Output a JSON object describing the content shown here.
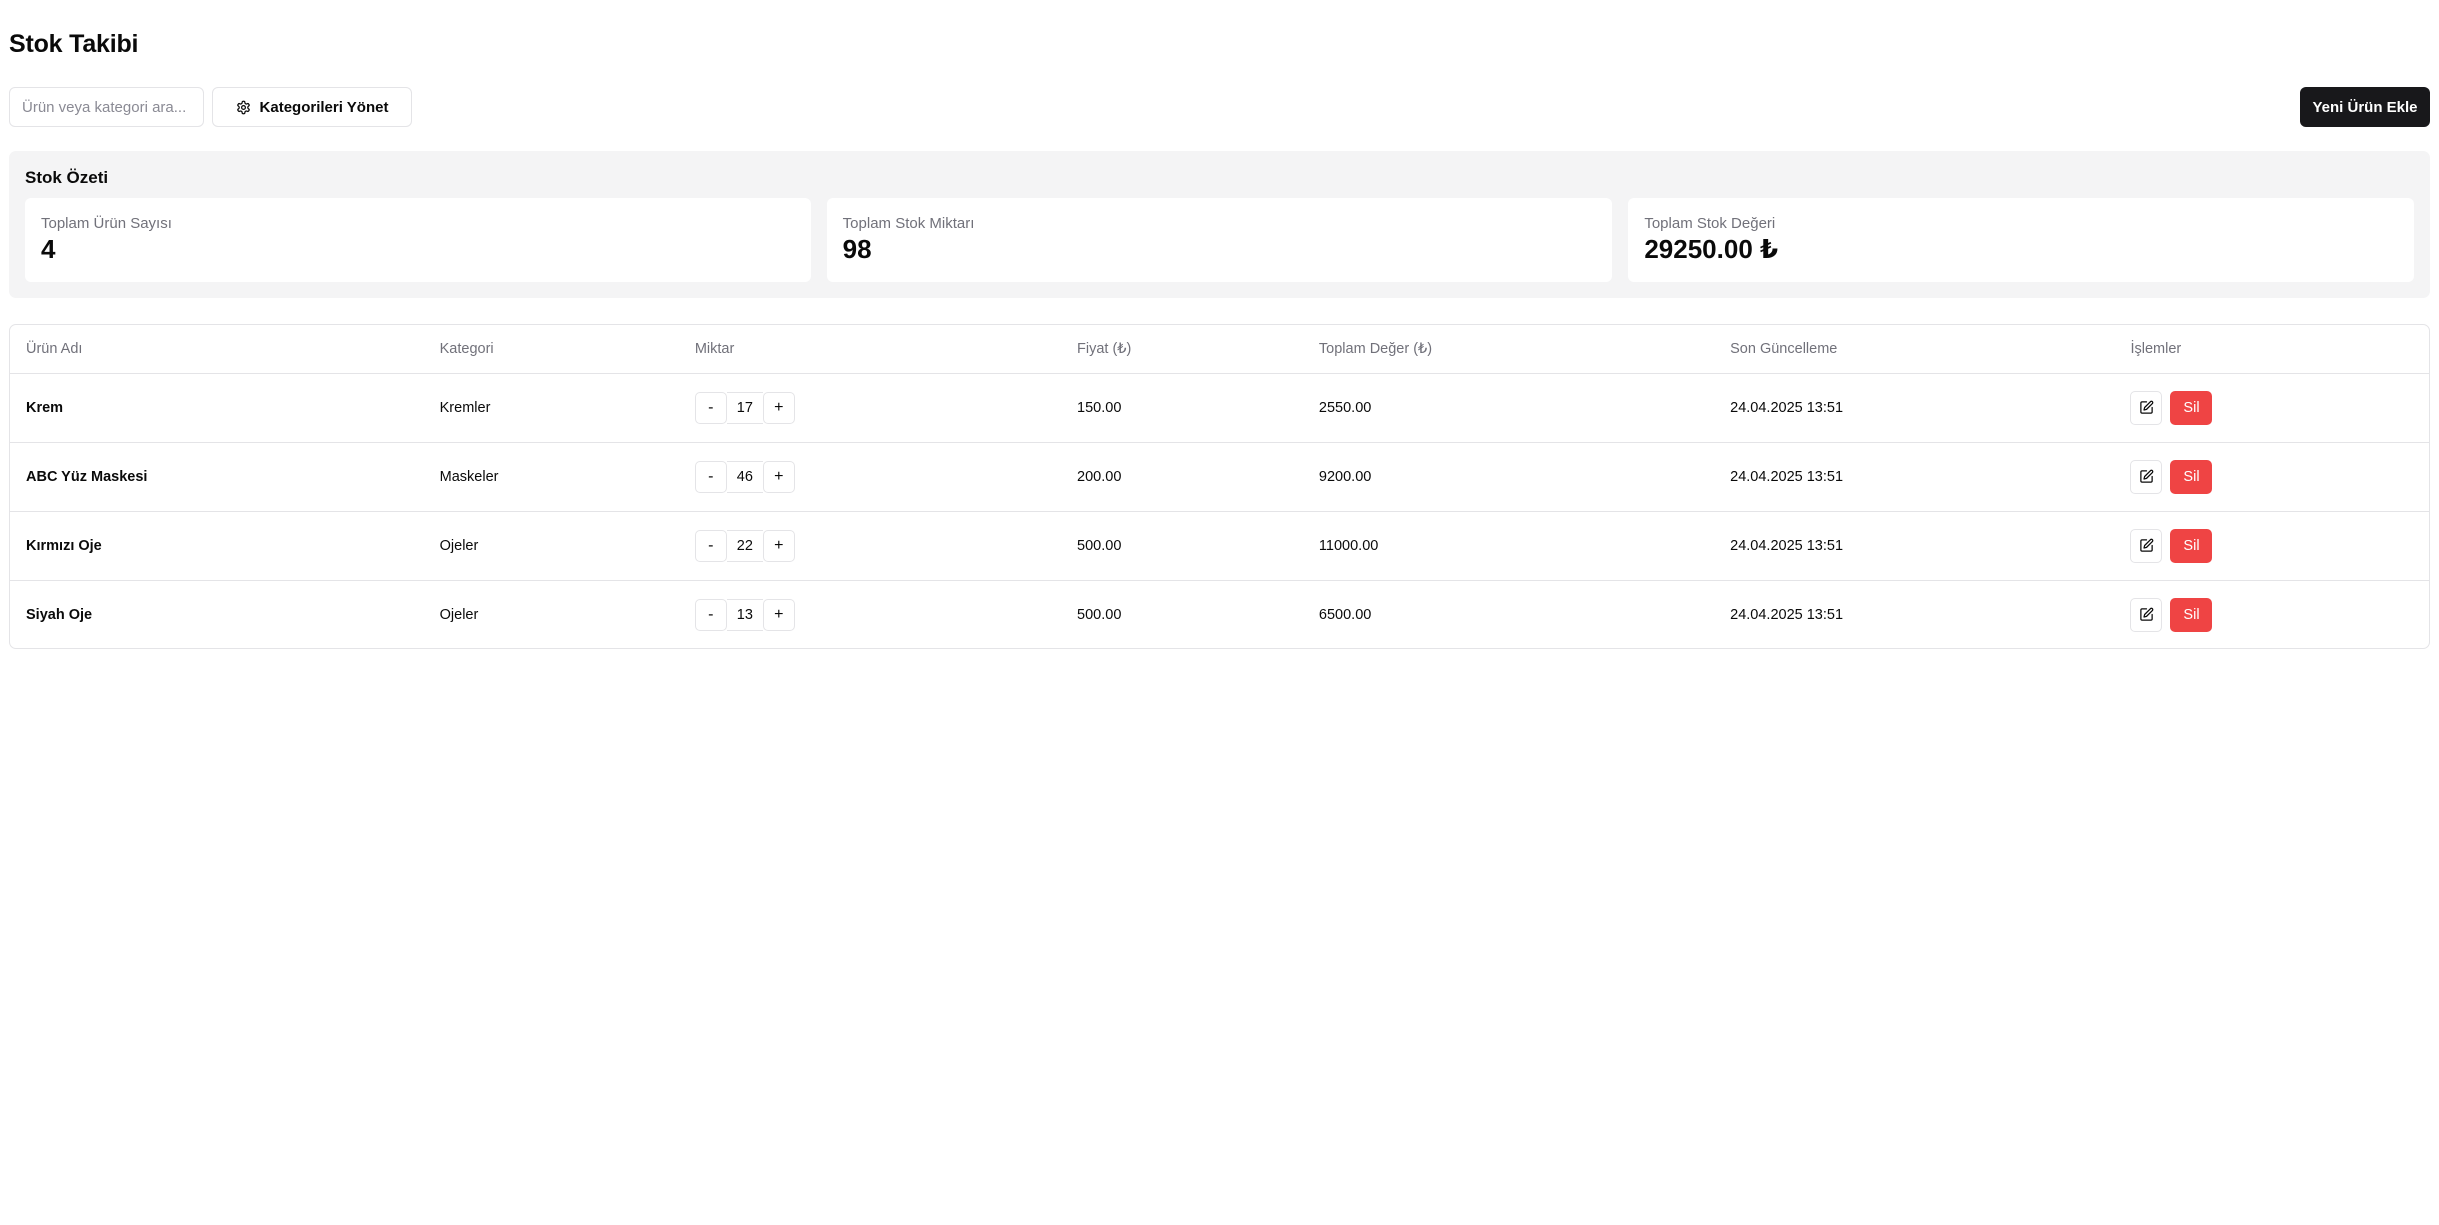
{
  "page": {
    "title": "Stok Takibi"
  },
  "toolbar": {
    "search_placeholder": "Ürün veya kategori ara...",
    "search_value": "",
    "manage_label": "Kategorileri Yönet",
    "new_label": "Yeni Ürün Ekle"
  },
  "summary": {
    "title": "Stok Özeti",
    "cards": [
      {
        "label": "Toplam Ürün Sayısı",
        "value": "4"
      },
      {
        "label": "Toplam Stok Miktarı",
        "value": "98"
      },
      {
        "label": "Toplam Stok Değeri",
        "value": "29250.00 ₺"
      }
    ]
  },
  "table": {
    "headers": [
      "Ürün Adı",
      "Kategori",
      "Miktar",
      "Fiyat (₺)",
      "Toplam Değer (₺)",
      "Son Güncelleme",
      "İşlemler"
    ],
    "rows": [
      {
        "name": "Krem",
        "category": "Kremler",
        "qty": "17",
        "price": "150.00",
        "total": "2550.00",
        "updated": "24.04.2025 13:51"
      },
      {
        "name": "ABC Yüz Maskesi",
        "category": "Maskeler",
        "qty": "46",
        "price": "200.00",
        "total": "9200.00",
        "updated": "24.04.2025 13:51"
      },
      {
        "name": "Kırmızı Oje",
        "category": "Ojeler",
        "qty": "22",
        "price": "500.00",
        "total": "11000.00",
        "updated": "24.04.2025 13:51"
      },
      {
        "name": "Siyah Oje",
        "category": "Ojeler",
        "qty": "13",
        "price": "500.00",
        "total": "6500.00",
        "updated": "24.04.2025 13:51"
      }
    ],
    "qty_decrement": "-",
    "qty_increment": "+",
    "delete_label": "Sil"
  },
  "icons": {
    "manage": "gear-icon",
    "edit": "edit-icon"
  },
  "colors": {
    "primary": "#18181b",
    "danger": "#ef4444",
    "muted": "#71717a",
    "summary_bg": "#f4f4f5",
    "border": "#e4e4e7"
  }
}
